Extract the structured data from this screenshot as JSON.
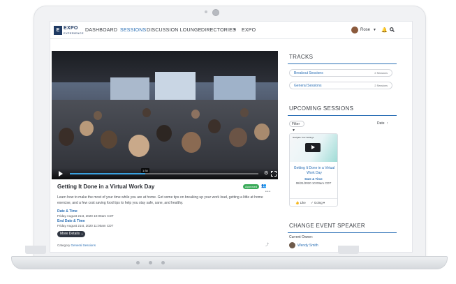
{
  "logo": {
    "mark": "E",
    "word": "EXPO",
    "sub": "EXPERIENCE"
  },
  "nav": {
    "items": [
      {
        "label": "DASHBOARD",
        "active": false
      },
      {
        "label": "SESSIONS",
        "active": true
      },
      {
        "label": "DISCUSSION LOUNGE",
        "active": false
      },
      {
        "label": "DIRECTORIES",
        "active": false
      },
      {
        "label": "EXPO",
        "active": false
      }
    ],
    "user_name": "Rose",
    "icons": [
      "bell-icon",
      "search-icon"
    ]
  },
  "video": {
    "time": "1:34",
    "progress": 0.4
  },
  "session": {
    "title": "Getting It Done in a Virtual Work Day",
    "status_badge": "Approved",
    "description": "Learn how to make the most of your time while you are at home. Get some tips on breaking up your work load, getting a little at home exercise, and a few cost saving food tips to help you stay safe, sane, and healthy.",
    "start_label": "Date & Time",
    "start_value": "Friday August 21st, 2020 10:00am CDT",
    "end_label": "End Date & Time",
    "end_value": "Friday August 21st, 2020 11:00am CDT",
    "more_button": "More Details",
    "category_label": "Category",
    "category_value": "General Sessions"
  },
  "tracks": {
    "title": "TRACKS",
    "rows": [
      {
        "name": "Breakout Sessions",
        "count": "2 Sessions"
      },
      {
        "name": "General Sessions",
        "count": "2 Sessions"
      }
    ]
  },
  "upcoming": {
    "title": "UPCOMING SESSIONS",
    "filter_label": "Filter",
    "sort_label": "Date",
    "card": {
      "thumb_caption": "Navigate Your Settings",
      "title": "Getting It Done in a Virtual Work Day",
      "date_label": "Date & Time",
      "date_value": "08/21/2020 10:00am CDT",
      "like_label": "Like",
      "going_label": "Going"
    }
  },
  "speaker": {
    "title": "CHANGE EVENT SPEAKER",
    "owner_label": "Current Owner:",
    "owner_name": "Wendy Smith"
  },
  "colors": {
    "accent": "#2a6fb5",
    "approved": "#3bab5a",
    "dark": "#2f3541"
  }
}
